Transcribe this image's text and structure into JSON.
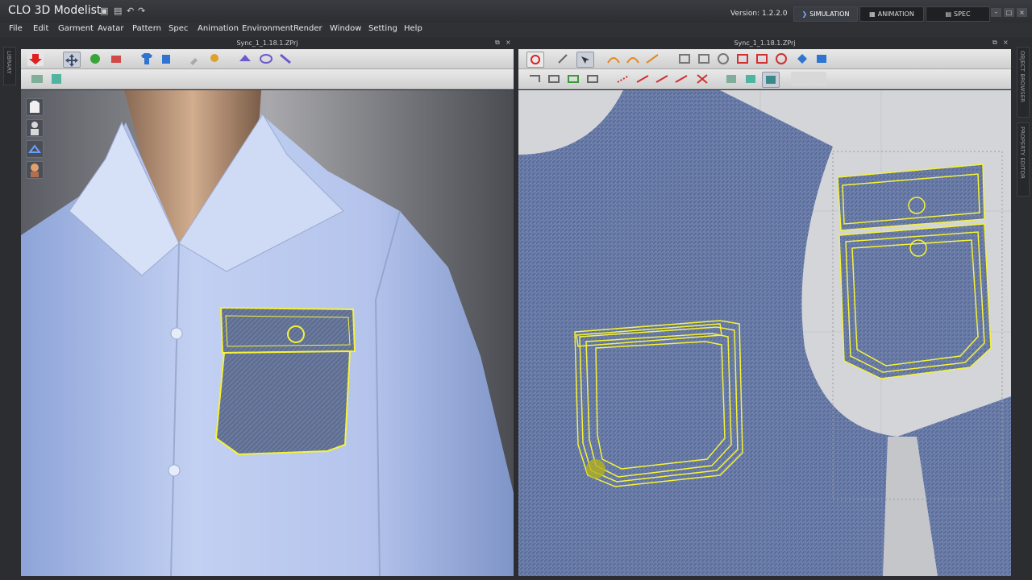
{
  "app": {
    "brand_prefix": "CLO",
    "brand_name": "3D Modelist",
    "version_label": "Version:",
    "version_value": "1.2.2.0"
  },
  "modes": [
    {
      "label": "SIMULATION"
    },
    {
      "label": "ANIMATION"
    },
    {
      "label": "SPEC"
    }
  ],
  "menu": [
    "File",
    "Edit",
    "Garment",
    "Avatar",
    "Pattern",
    "Spec",
    "Animation",
    "Environment",
    "Render",
    "Window",
    "Setting",
    "Help"
  ],
  "side_tabs": {
    "left": "LIBRARY",
    "right_top": "OBJECT BROWSER",
    "right_bottom": "PROPERTY EDITOR"
  },
  "panes": {
    "left_title": "Sync_1_1.18.1.ZPrj",
    "right_title": "Sync_1_1.18.1.ZPrj"
  },
  "colors": {
    "selection": "#f5f23a",
    "shirt": "#b9c8ee",
    "denim": "#5a6fa0",
    "toolbar_bg": "#dcdcdc"
  },
  "avatar_controls": [
    {
      "icon": "shirt-icon"
    },
    {
      "icon": "avatar-gray-icon"
    },
    {
      "icon": "hanger-icon"
    },
    {
      "icon": "avatar-skin-icon"
    }
  ]
}
